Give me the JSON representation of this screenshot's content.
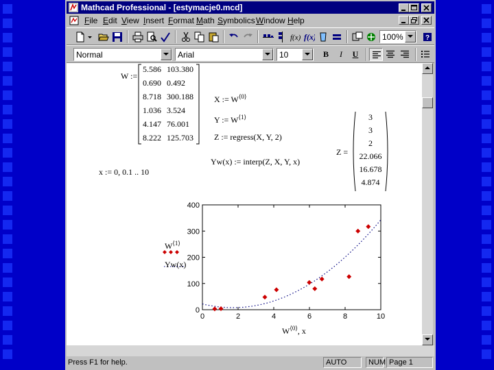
{
  "window": {
    "title": "Mathcad Professional - [estymacje0.mcd]"
  },
  "menu": [
    "File",
    "Edit",
    "View",
    "Insert",
    "Format",
    "Math",
    "Symbolics",
    "Window",
    "Help"
  ],
  "toolbar": {
    "zoom": "100%"
  },
  "format_toolbar": {
    "style": "Normal",
    "font": "Arial",
    "size": "10",
    "bold": "B",
    "italic": "I",
    "underline": "U"
  },
  "worksheet": {
    "W_label": "W :=",
    "W_matrix": [
      [
        "5.586",
        "103.380"
      ],
      [
        "0.690",
        "0.492"
      ],
      [
        "8.718",
        "300.188"
      ],
      [
        "1.036",
        "3.524"
      ],
      [
        "4.147",
        "76.001"
      ],
      [
        "8.222",
        "125.703"
      ]
    ],
    "X_def": "X := W",
    "X_sup": "⟨0⟩",
    "Y_def": "Y := W",
    "Y_sup": "⟨1⟩",
    "Z_def": "Z := regress(X, Y, 2)",
    "Yw_def": "Yw(x) := interp(Z, X, Y, x)",
    "x_range": "x := 0, 0.1 .. 10",
    "Z_label": "Z =",
    "Z_vector": [
      "3",
      "3",
      "2",
      "22.066",
      "16.678",
      "4.874"
    ],
    "plot_ylabel_1": "W",
    "plot_ylabel_1_sup": "⟨1⟩",
    "plot_ylabel_2": "Yw(x)",
    "plot_xlabel": "W",
    "plot_xlabel_sup": "⟨0⟩",
    "plot_xlabel_2": ", x"
  },
  "chart_data": {
    "type": "scatter",
    "xlim": [
      0,
      10
    ],
    "ylim": [
      0,
      400
    ],
    "x_ticks": [
      "0",
      "2",
      "4",
      "6",
      "8",
      "10"
    ],
    "y_ticks": [
      "0",
      "100",
      "200",
      "300",
      "400"
    ],
    "series": [
      {
        "points": [
          [
            0.69,
            3
          ],
          [
            1.04,
            4
          ],
          [
            3.5,
            48
          ],
          [
            4.15,
            76
          ],
          [
            5.99,
            104
          ],
          [
            6.3,
            80
          ],
          [
            6.7,
            117
          ],
          [
            8.22,
            126
          ],
          [
            8.72,
            300
          ],
          [
            9.3,
            317
          ]
        ],
        "style": "markers",
        "color": "#cc0000"
      },
      {
        "curve": "quadratic",
        "coefficients": [
          22.066,
          16.678,
          4.874
        ],
        "x_range": [
          0,
          10
        ],
        "style": "dotted",
        "color": "#000080"
      }
    ],
    "grid": false
  },
  "status": {
    "help": "Press F1 for help.",
    "mode": "AUTO",
    "num": "NUM",
    "page": "Page 1"
  }
}
